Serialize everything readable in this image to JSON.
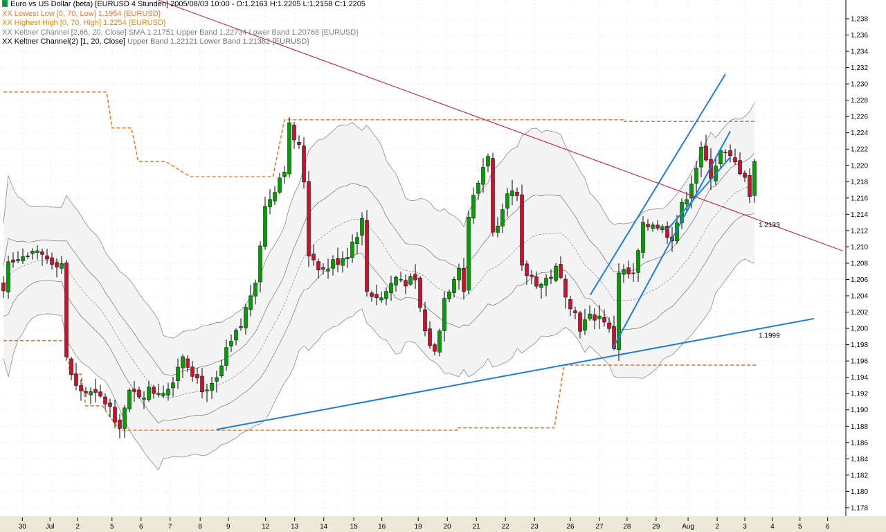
{
  "legend": {
    "title": "Euro vs US Dollar (beta) [EURUSD  4 Stunden] 2005/08/03 10:00 - O:1.2163 H:1.2205 L:1.2158 C:1.2205",
    "lowest_low": "XX Lowest Low [0, 70, Low] 1.1954 {EURUSD}",
    "highest_high": "XX Highest High [0, 70, High] 1.2254 {EURUSD}",
    "keltner": "XX Keltner Channel [2,66, 20, Close] SMA 1.21751 Upper Band 1.22734 Lower Band 1.20768 {EURUSD}",
    "keltner2_name": "XX Keltner Channel(2) [1, 20, Close]",
    "keltner2_values": " Upper Band 1.22121 Lower Band 1.21382 {EURUSD}"
  },
  "colors": {
    "up": "#00a000",
    "down": "#d0102a",
    "orange": "#f07820",
    "red_line": "#d01030",
    "blue_line": "#1a7ee0",
    "band_fill": "#f4f4f4",
    "band_line": "#8a8a8a"
  },
  "chart_data": {
    "type": "candlestick",
    "symbol": "EURUSD",
    "timeframe": "4 Stunden",
    "ylim": [
      1.177,
      1.239
    ],
    "y_ticks": [
      "1,178",
      "1,180",
      "1,182",
      "1,184",
      "1,186",
      "1,188",
      "1,190",
      "1,192",
      "1,194",
      "1,196",
      "1,198",
      "1,200",
      "1,202",
      "1,204",
      "1,206",
      "1,208",
      "1,210",
      "1,212",
      "1,214",
      "1,216",
      "1,218",
      "1,220",
      "1,222",
      "1,224",
      "1,226",
      "1,228",
      "1,230",
      "1,232",
      "1,234",
      "1,236",
      "1,238"
    ],
    "y_tick_values": [
      1.178,
      1.18,
      1.182,
      1.184,
      1.186,
      1.188,
      1.19,
      1.192,
      1.194,
      1.196,
      1.198,
      1.2,
      1.202,
      1.204,
      1.206,
      1.208,
      1.21,
      1.212,
      1.214,
      1.216,
      1.218,
      1.22,
      1.222,
      1.224,
      1.226,
      1.228,
      1.23,
      1.232,
      1.234,
      1.236,
      1.238
    ],
    "x_labels": [
      {
        "label": "30",
        "i": 3.9
      },
      {
        "label": "Jul",
        "i": 9.6
      },
      {
        "label": "2",
        "i": 15.3
      },
      {
        "label": "5",
        "i": 22.4
      },
      {
        "label": "6",
        "i": 28.4
      },
      {
        "label": "7",
        "i": 34.4
      },
      {
        "label": "8",
        "i": 40.6
      },
      {
        "label": "9",
        "i": 46.4
      },
      {
        "label": "12",
        "i": 54.1
      },
      {
        "label": "13",
        "i": 60.1
      },
      {
        "label": "14",
        "i": 66.1
      },
      {
        "label": "15",
        "i": 72.3
      },
      {
        "label": "16",
        "i": 78.1
      },
      {
        "label": "19",
        "i": 85.6
      },
      {
        "label": "20",
        "i": 91.6
      },
      {
        "label": "21",
        "i": 97.6
      },
      {
        "label": "22",
        "i": 103.6
      },
      {
        "label": "23",
        "i": 109.6
      },
      {
        "label": "26",
        "i": 117
      },
      {
        "label": "27",
        "i": 123
      },
      {
        "label": "28",
        "i": 128.7
      },
      {
        "label": "29",
        "i": 134.7
      },
      {
        "label": "Aug",
        "i": 141.3
      },
      {
        "label": "2",
        "i": 147.3
      },
      {
        "label": "3",
        "i": 153
      },
      {
        "label": "4",
        "i": 158.7
      },
      {
        "label": "5",
        "i": 164.4
      },
      {
        "label": "6",
        "i": 170.1
      }
    ],
    "close_keypoints": [
      [
        0,
        1.2046
      ],
      [
        1,
        1.2088
      ],
      [
        8,
        1.2088
      ],
      [
        12,
        1.208
      ],
      [
        13,
        1.1961
      ],
      [
        15,
        1.1927
      ],
      [
        21,
        1.191
      ],
      [
        24,
        1.1884
      ],
      [
        26,
        1.1918
      ],
      [
        34,
        1.1927
      ],
      [
        37,
        1.1969
      ],
      [
        42,
        1.1918
      ],
      [
        44,
        1.1935
      ],
      [
        46,
        1.1969
      ],
      [
        49,
        1.2003
      ],
      [
        52,
        1.2063
      ],
      [
        54,
        1.2148
      ],
      [
        58,
        1.2199
      ],
      [
        59,
        1.2246
      ],
      [
        61,
        1.222
      ],
      [
        62,
        1.2182
      ],
      [
        63,
        1.2093
      ],
      [
        66,
        1.2071
      ],
      [
        71,
        1.2093
      ],
      [
        74,
        1.2131
      ],
      [
        75,
        1.2046
      ],
      [
        78,
        1.2037
      ],
      [
        81,
        1.2063
      ],
      [
        85,
        1.2054
      ],
      [
        87,
        1.1995
      ],
      [
        89,
        1.1969
      ],
      [
        91,
        1.2037
      ],
      [
        94,
        1.208
      ],
      [
        95,
        1.2046
      ],
      [
        96,
        1.2139
      ],
      [
        99,
        1.2199
      ],
      [
        100,
        1.2216
      ],
      [
        101,
        1.2114
      ],
      [
        104,
        1.2173
      ],
      [
        106,
        1.2156
      ],
      [
        107,
        1.2071
      ],
      [
        111,
        1.2054
      ],
      [
        114,
        1.2071
      ],
      [
        116,
        1.2046
      ],
      [
        119,
        1.2003
      ],
      [
        122,
        1.2016
      ],
      [
        124,
        1.2012
      ],
      [
        126,
        1.1978
      ],
      [
        127,
        1.2071
      ],
      [
        130,
        1.2063
      ],
      [
        132,
        1.2122
      ],
      [
        134,
        1.2131
      ],
      [
        136,
        1.2122
      ],
      [
        138,
        1.2114
      ],
      [
        140,
        1.2148
      ],
      [
        142,
        1.2182
      ],
      [
        144,
        1.2216
      ],
      [
        146,
        1.219
      ],
      [
        148,
        1.2216
      ],
      [
        150,
        1.2207
      ],
      [
        153,
        1.219
      ],
      [
        154,
        1.2163
      ],
      [
        155,
        1.2205
      ]
    ],
    "highest_high_steps": [
      [
        0,
        21.3,
        1.229
      ],
      [
        22.4,
        26.4,
        1.2246
      ],
      [
        27.8,
        33.4,
        1.2205
      ],
      [
        38.6,
        55.6,
        1.2186
      ],
      [
        58,
        127.9,
        1.2256
      ],
      [
        127.9,
        155.5,
        1.2254
      ]
    ],
    "lowest_low_steps": [
      [
        0,
        12.9,
        1.1985
      ],
      [
        13.7,
        16,
        1.1944
      ],
      [
        17,
        20.4,
        1.1905
      ],
      [
        24,
        93.6,
        1.1875
      ],
      [
        93.6,
        113.7,
        1.1878
      ],
      [
        115.7,
        155.5,
        1.1955
      ]
    ],
    "trendlines": [
      {
        "name": "red-resistance",
        "color": "red_line",
        "from": [
          31.9,
          1.2403
        ],
        "to": [
          173.3,
          1.2095
        ],
        "label": "1.2133",
        "label_i": 155.3
      },
      {
        "name": "blue-support",
        "color": "blue_line",
        "from": [
          44,
          1.1876
        ],
        "to": [
          167.3,
          1.2012
        ],
        "label": "1.1999",
        "label_i": 155.3
      },
      {
        "name": "blue-channel-upper",
        "color": "blue_line",
        "from": [
          121.1,
          1.2041
        ],
        "to": [
          149,
          1.2312
        ]
      },
      {
        "name": "blue-channel-lower",
        "color": "blue_line",
        "from": [
          125.7,
          1.1975
        ],
        "to": [
          150,
          1.2242
        ]
      },
      {
        "name": "blue-channel-inner",
        "color": "blue_line",
        "from": [
          137,
          1.2121
        ],
        "to": [
          150,
          1.221
        ]
      }
    ],
    "indicators": {
      "keltner_outer": {
        "period": 20,
        "mult": 2.66
      },
      "keltner_inner": {
        "period": 20,
        "mult": 1
      }
    }
  }
}
